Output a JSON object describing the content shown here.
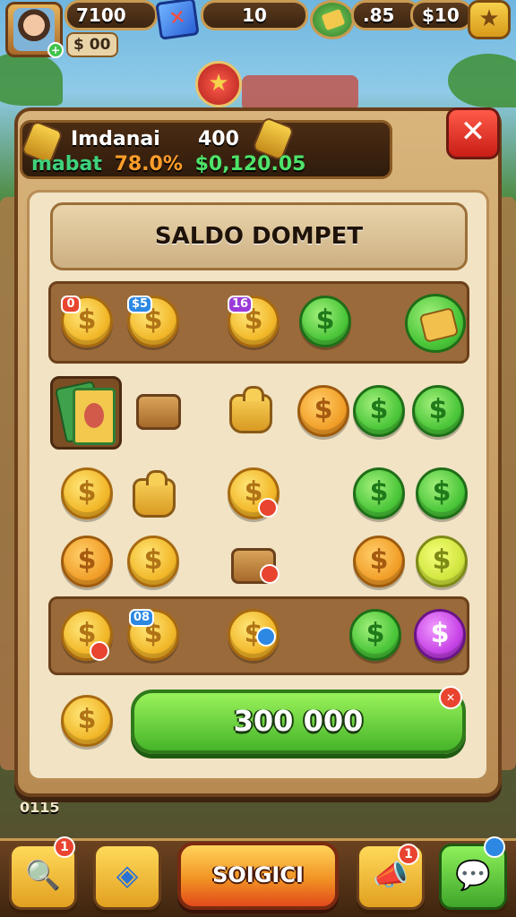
{
  "hud": {
    "coins_value": "7100",
    "small_value": "$ 00",
    "level_value": "10",
    "money_value": ".85",
    "cash_value": "$10"
  },
  "header": {
    "title": "Imdanai",
    "number": "400",
    "sub_label": "mabat",
    "sub_percent": "78.0%",
    "sub_amount": "$0,120.05"
  },
  "panel": {
    "title": "SALDO DOMPET",
    "amount_button": "300 000"
  },
  "coin_badges": {
    "row1_a": "0",
    "row1_b": "$5",
    "row1_c": "16",
    "row5_b": "08"
  },
  "bottom_nav": {
    "main_button": "SOIGICI",
    "notif_1": "1",
    "notif_2": "1"
  },
  "side_texts": {
    "left_bottom": "0115"
  },
  "colors": {
    "panel_brown": "#6b401b",
    "accent_green": "#46b52a",
    "close_red": "#e9442f",
    "coin_gold": "#f2b82a"
  },
  "icons": [
    "avatar",
    "gem-icon",
    "cart-icon",
    "star-icon",
    "close-icon",
    "search-icon",
    "map-icon",
    "megaphone-icon",
    "chat-icon",
    "dollar-coin-icon",
    "wallet-icon",
    "money-bag-icon"
  ]
}
